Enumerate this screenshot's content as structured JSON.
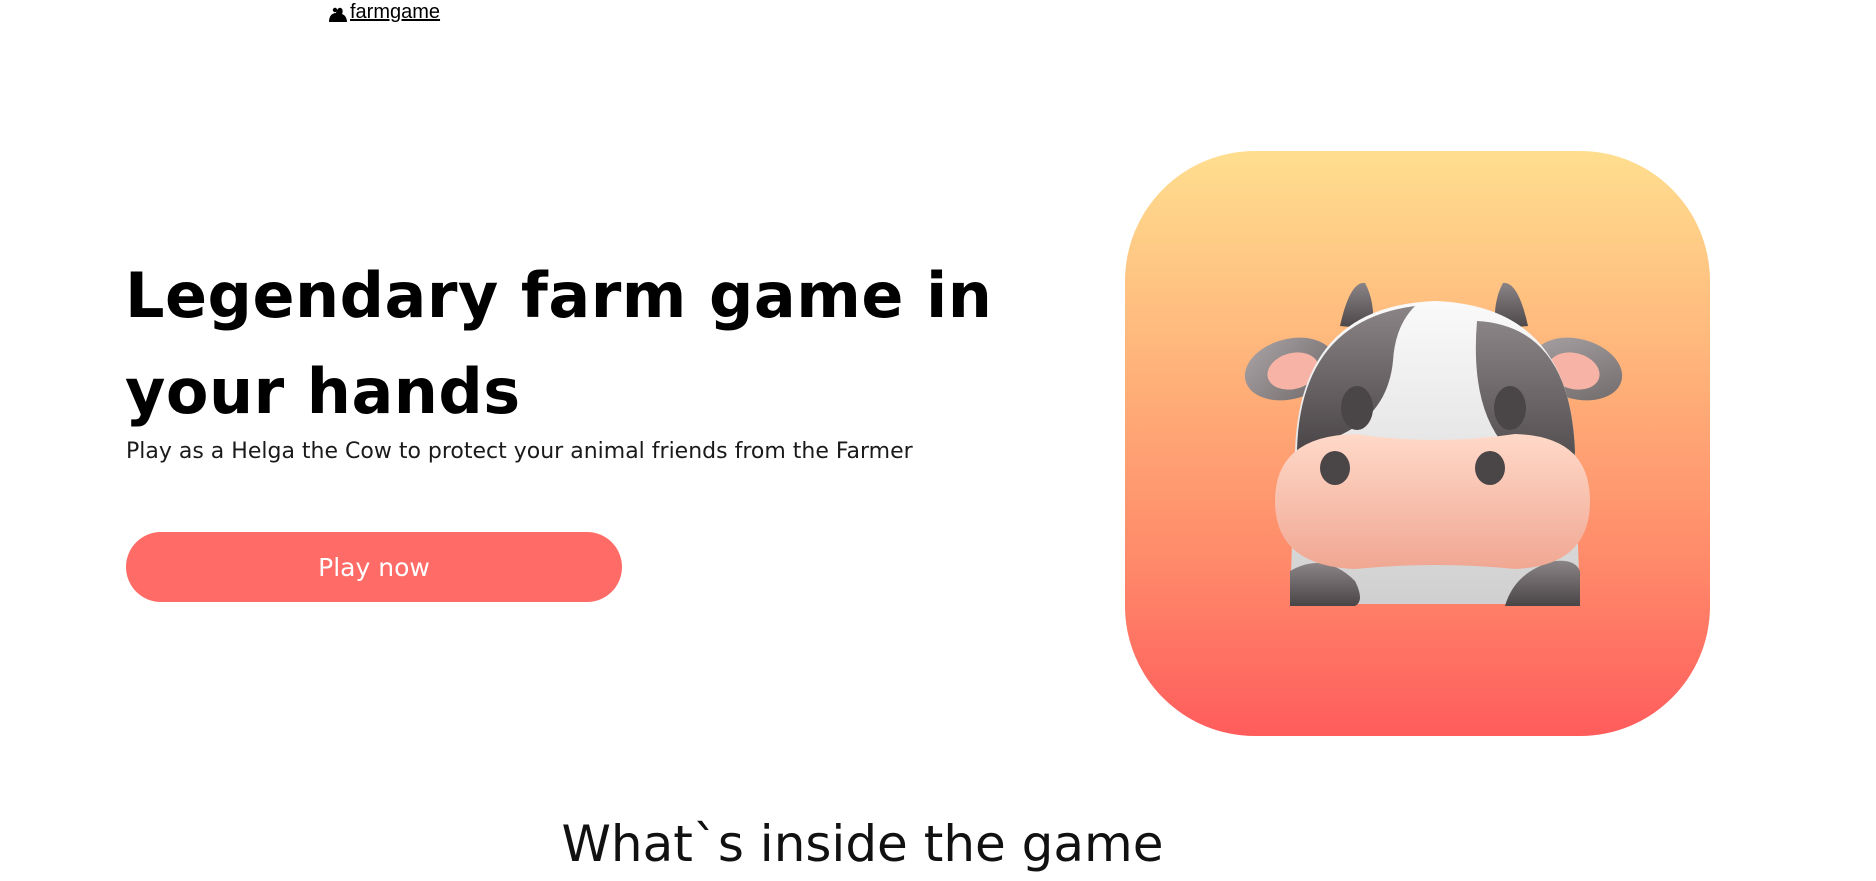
{
  "nav": {
    "logo_icon": "cow-silhouette-icon",
    "logo_text": "farmgame"
  },
  "hero": {
    "title": "Legendary farm game in your hands",
    "subtitle": "Play as a Helga the Cow to protect your animal friends from the Farmer",
    "cta_label": "Play now",
    "app_icon": "cow-face-icon"
  },
  "features": {
    "heading": "What`s inside the game"
  },
  "colors": {
    "accent": "#ff6b66",
    "icon_gradient_top": "#ffde8f",
    "icon_gradient_bottom": "#ff5c5c"
  }
}
